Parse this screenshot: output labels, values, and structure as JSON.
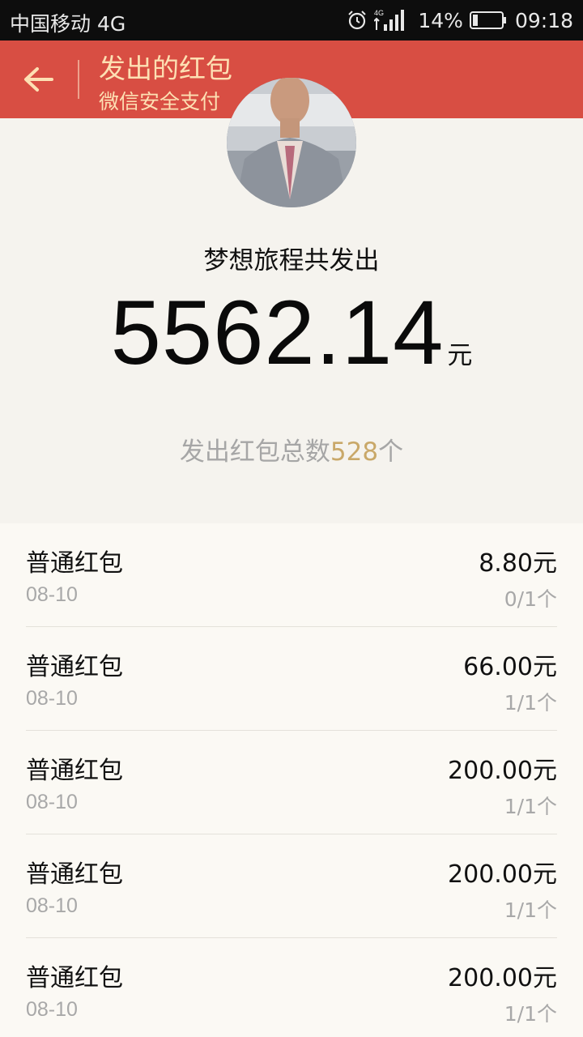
{
  "status_bar": {
    "carrier": "中国移动 4G",
    "network_badge": "4G",
    "battery": "14%",
    "time": "09:18"
  },
  "header": {
    "title": "发出的红包",
    "subtitle": "微信安全支付",
    "accent_color": "#d84e43"
  },
  "summary": {
    "sender_text": "梦想旅程共发出",
    "total_amount": "5562.14",
    "currency_unit": "元",
    "count_prefix": "发出红包总数",
    "count_value": "528",
    "count_suffix": "个"
  },
  "records": [
    {
      "type": "普通红包",
      "date": "08-10",
      "amount": "8.80元",
      "opened": "0/1个"
    },
    {
      "type": "普通红包",
      "date": "08-10",
      "amount": "66.00元",
      "opened": "1/1个"
    },
    {
      "type": "普通红包",
      "date": "08-10",
      "amount": "200.00元",
      "opened": "1/1个"
    },
    {
      "type": "普通红包",
      "date": "08-10",
      "amount": "200.00元",
      "opened": "1/1个"
    },
    {
      "type": "普通红包",
      "date": "08-10",
      "amount": "200.00元",
      "opened": "1/1个"
    }
  ]
}
